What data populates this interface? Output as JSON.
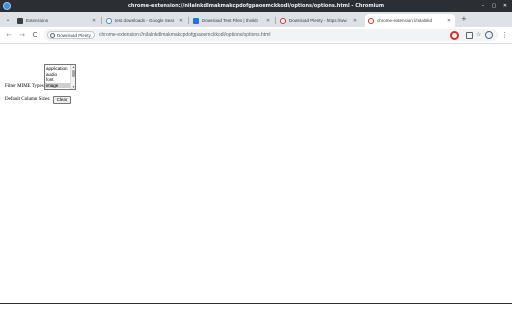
{
  "window": {
    "title": "chrome-extension://niIalnkdlmakmakcpdofgpaoemckkodi/options/options.html - Chromium",
    "controls": [
      "–",
      "▢",
      "✕"
    ]
  },
  "tabs": [
    {
      "label": "Extensions",
      "favicon": "puzzle-icon",
      "color": "#3c4043",
      "active": false
    },
    {
      "label": "test downloads - Google Sear",
      "favicon": "google-icon",
      "color": "#4285f4",
      "active": false
    },
    {
      "label": "Download Test Files | thinkb",
      "favicon": "page-icon",
      "color": "#1a73e8",
      "active": false
    },
    {
      "label": "Download Plenty - https://ww",
      "favicon": "plenty-icon",
      "color": "#d93025",
      "active": false
    },
    {
      "label": "chrome-extension://niIalnkd",
      "favicon": "plenty-icon",
      "color": "#d93025",
      "active": true
    }
  ],
  "toolbar": {
    "back": "←",
    "forward": "→",
    "reload": "C",
    "chip_label": "Download Plenty",
    "url": "chrome-extension://niIalnkdlmakmakcpdofgpaoemckkodi/options/options.html",
    "star": "☆",
    "menu": "⋮"
  },
  "options": {
    "filter_label": "Filter MIME Types:",
    "mime_options": [
      "application",
      "audio",
      "font",
      "image"
    ],
    "selected_index": 3,
    "default_column_label": "Default Column Sizes:",
    "clear_label": "Clear"
  },
  "colors": {
    "titlebar": "#2b2f33",
    "tabstrip": "#dee1e6",
    "accent_red": "#d93025"
  }
}
